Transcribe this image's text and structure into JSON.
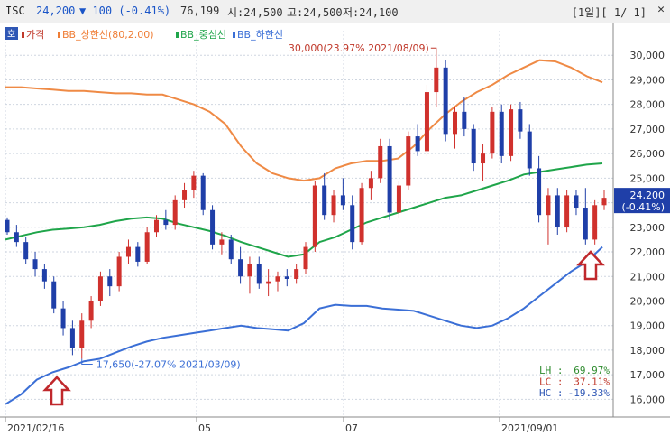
{
  "titlebar": {
    "ticker": "ISC",
    "price": "24,200",
    "change": "▼ 100 (-0.41%)",
    "volume": "76,199",
    "open": "시:24,500",
    "high": "고:24,500",
    "low": "저:24,100",
    "range": "[1일][ 1/ 1]",
    "close_icon": "✕"
  },
  "legend": {
    "corner_label": "호",
    "items": [
      {
        "label": "가격",
        "color": "#c0392b"
      },
      {
        "label": "BB_상한선(80,2.00)",
        "color": "#ef7d35"
      },
      {
        "label": "BB_중심선",
        "color": "#1fa54a"
      },
      {
        "label": "BB_하한선",
        "color": "#3b6fd6"
      }
    ]
  },
  "chart_data": {
    "type": "candlestick",
    "x_tick_labels": [
      "2021/02/16",
      "05",
      "07",
      "2021/09/01"
    ],
    "y_ticks": [
      "16,000",
      "17,000",
      "18,000",
      "19,000",
      "20,000",
      "21,000",
      "22,000",
      "23,000",
      "24,000",
      "25,000",
      "26,000",
      "27,000",
      "28,000",
      "29,000",
      "30,000"
    ],
    "ylim": [
      15500,
      31000
    ],
    "current_value": "24,200",
    "current_change": "(-0.41%)",
    "annotations": {
      "high": "30,000(23.97% 2021/08/09)",
      "low": "17,650(-27.07% 2021/03/09)"
    },
    "stats": [
      {
        "label": "LH",
        "value": "69.97%",
        "color": "#2e8b2e"
      },
      {
        "label": "LC",
        "value": "37.11%",
        "color": "#c0392b"
      },
      {
        "label": "HC",
        "value": "-19.33%",
        "color": "#2f57b5"
      }
    ],
    "bollinger": {
      "upper": [
        28700,
        28700,
        28650,
        28600,
        28550,
        28550,
        28500,
        28450,
        28450,
        28400,
        28400,
        28200,
        28000,
        27700,
        27200,
        26300,
        25600,
        25200,
        25000,
        24900,
        25000,
        25400,
        25600,
        25700,
        25700,
        25800,
        26300,
        27000,
        27600,
        28100,
        28500,
        28800,
        29200,
        29500,
        29800,
        29750,
        29500,
        29150,
        28900
      ],
      "middle": [
        22500,
        22650,
        22800,
        22900,
        22950,
        23000,
        23100,
        23250,
        23350,
        23400,
        23350,
        23150,
        23000,
        22850,
        22650,
        22400,
        22200,
        22000,
        21800,
        21900,
        22400,
        22600,
        22900,
        23200,
        23400,
        23600,
        23800,
        24000,
        24200,
        24300,
        24500,
        24700,
        24900,
        25150,
        25250,
        25350,
        25450,
        25550,
        25600
      ],
      "lower": [
        15800,
        16200,
        16800,
        17100,
        17300,
        17550,
        17650,
        17900,
        18150,
        18350,
        18500,
        18600,
        18700,
        18800,
        18900,
        19000,
        18900,
        18850,
        18800,
        19100,
        19700,
        19850,
        19800,
        19800,
        19700,
        19650,
        19600,
        19400,
        19200,
        19000,
        18900,
        19000,
        19300,
        19700,
        20200,
        20700,
        21200,
        21600,
        22200
      ]
    },
    "candles": [
      [
        23300,
        23400,
        22700,
        22800
      ],
      [
        22800,
        23100,
        22200,
        22400
      ],
      [
        22400,
        22600,
        21500,
        21700
      ],
      [
        21700,
        22000,
        21000,
        21300
      ],
      [
        21300,
        21500,
        20500,
        20800
      ],
      [
        20800,
        21000,
        19500,
        19700
      ],
      [
        19700,
        20000,
        18600,
        18900
      ],
      [
        18900,
        19200,
        17800,
        18100
      ],
      [
        18100,
        19500,
        17650,
        19200
      ],
      [
        19200,
        20200,
        18900,
        20000
      ],
      [
        20000,
        21200,
        19800,
        21000
      ],
      [
        21000,
        21300,
        20200,
        20600
      ],
      [
        20600,
        22000,
        20400,
        21800
      ],
      [
        21800,
        22500,
        21500,
        22200
      ],
      [
        22200,
        22400,
        21400,
        21600
      ],
      [
        21600,
        23000,
        21500,
        22800
      ],
      [
        22800,
        23500,
        22600,
        23300
      ],
      [
        23300,
        23700,
        22900,
        23100
      ],
      [
        23100,
        24300,
        22900,
        24100
      ],
      [
        24100,
        24800,
        23800,
        24500
      ],
      [
        24500,
        25300,
        24200,
        25100
      ],
      [
        25100,
        25200,
        23500,
        23700
      ],
      [
        23700,
        23900,
        22100,
        22300
      ],
      [
        22300,
        22800,
        21900,
        22500
      ],
      [
        22500,
        22700,
        21500,
        21700
      ],
      [
        21700,
        22200,
        20700,
        21000
      ],
      [
        21000,
        21800,
        20300,
        21500
      ],
      [
        21500,
        21800,
        20500,
        20700
      ],
      [
        20700,
        21300,
        20200,
        20800
      ],
      [
        20800,
        21200,
        20400,
        21000
      ],
      [
        21000,
        21300,
        20600,
        20900
      ],
      [
        20900,
        21500,
        20700,
        21300
      ],
      [
        21300,
        22400,
        21100,
        22200
      ],
      [
        22200,
        24900,
        22000,
        24700
      ],
      [
        24700,
        25200,
        23300,
        23500
      ],
      [
        23500,
        24500,
        23200,
        24300
      ],
      [
        24300,
        25000,
        23700,
        23900
      ],
      [
        23900,
        24300,
        22100,
        22400
      ],
      [
        22400,
        24800,
        22300,
        24600
      ],
      [
        24600,
        25300,
        24100,
        25000
      ],
      [
        25000,
        26600,
        24800,
        26300
      ],
      [
        26300,
        26600,
        23300,
        23600
      ],
      [
        23600,
        24900,
        23400,
        24700
      ],
      [
        24700,
        26900,
        24500,
        26700
      ],
      [
        26700,
        27200,
        25900,
        26100
      ],
      [
        26100,
        28800,
        25900,
        28500
      ],
      [
        28500,
        30000,
        27900,
        29500
      ],
      [
        29500,
        29800,
        26500,
        26800
      ],
      [
        26800,
        27900,
        26200,
        27700
      ],
      [
        27700,
        28300,
        26700,
        27000
      ],
      [
        27000,
        27200,
        25300,
        25600
      ],
      [
        25600,
        26400,
        24900,
        26000
      ],
      [
        26000,
        27900,
        25800,
        27700
      ],
      [
        27700,
        28000,
        25600,
        25900
      ],
      [
        25900,
        28000,
        25700,
        27800
      ],
      [
        27800,
        28100,
        26600,
        26900
      ],
      [
        26900,
        27200,
        25100,
        25400
      ],
      [
        25400,
        25900,
        23200,
        23500
      ],
      [
        23500,
        24600,
        22300,
        24300
      ],
      [
        24300,
        24600,
        22700,
        23000
      ],
      [
        23000,
        24500,
        22800,
        24300
      ],
      [
        24300,
        24500,
        23500,
        23800
      ],
      [
        23800,
        24600,
        22300,
        22500
      ],
      [
        22500,
        24100,
        22300,
        23900
      ],
      [
        23900,
        24500,
        23700,
        24200
      ]
    ]
  }
}
